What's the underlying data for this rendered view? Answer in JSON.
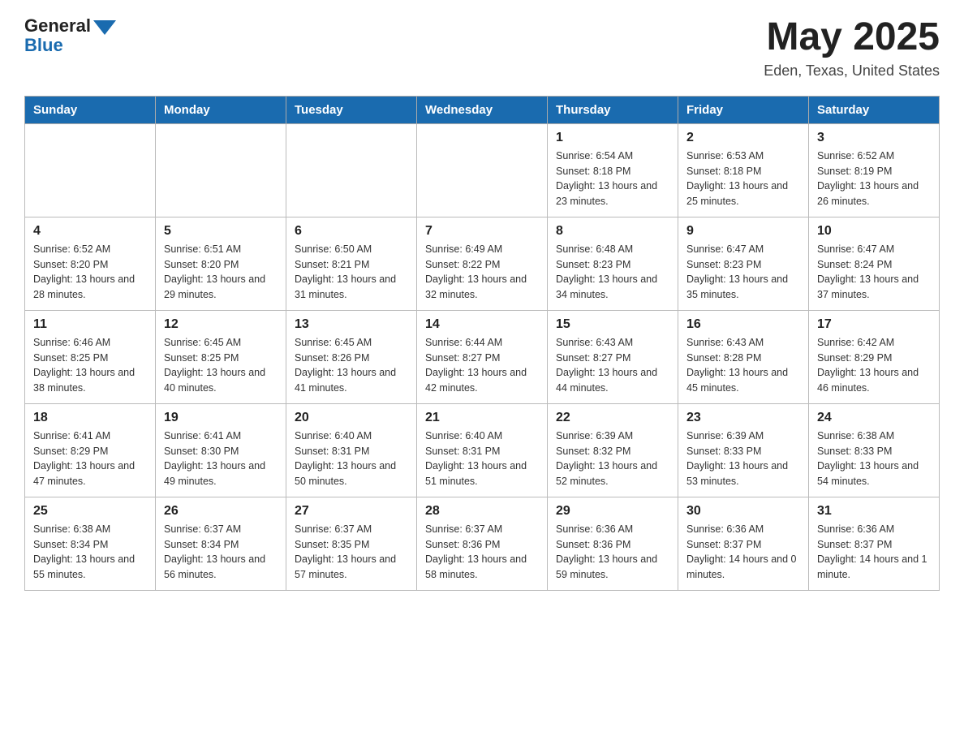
{
  "header": {
    "logo_text_general": "General",
    "logo_text_blue": "Blue",
    "calendar_title": "May 2025",
    "calendar_subtitle": "Eden, Texas, United States"
  },
  "days_of_week": [
    "Sunday",
    "Monday",
    "Tuesday",
    "Wednesday",
    "Thursday",
    "Friday",
    "Saturday"
  ],
  "weeks": [
    [
      {
        "day": "",
        "info": ""
      },
      {
        "day": "",
        "info": ""
      },
      {
        "day": "",
        "info": ""
      },
      {
        "day": "",
        "info": ""
      },
      {
        "day": "1",
        "info": "Sunrise: 6:54 AM\nSunset: 8:18 PM\nDaylight: 13 hours and 23 minutes."
      },
      {
        "day": "2",
        "info": "Sunrise: 6:53 AM\nSunset: 8:18 PM\nDaylight: 13 hours and 25 minutes."
      },
      {
        "day": "3",
        "info": "Sunrise: 6:52 AM\nSunset: 8:19 PM\nDaylight: 13 hours and 26 minutes."
      }
    ],
    [
      {
        "day": "4",
        "info": "Sunrise: 6:52 AM\nSunset: 8:20 PM\nDaylight: 13 hours and 28 minutes."
      },
      {
        "day": "5",
        "info": "Sunrise: 6:51 AM\nSunset: 8:20 PM\nDaylight: 13 hours and 29 minutes."
      },
      {
        "day": "6",
        "info": "Sunrise: 6:50 AM\nSunset: 8:21 PM\nDaylight: 13 hours and 31 minutes."
      },
      {
        "day": "7",
        "info": "Sunrise: 6:49 AM\nSunset: 8:22 PM\nDaylight: 13 hours and 32 minutes."
      },
      {
        "day": "8",
        "info": "Sunrise: 6:48 AM\nSunset: 8:23 PM\nDaylight: 13 hours and 34 minutes."
      },
      {
        "day": "9",
        "info": "Sunrise: 6:47 AM\nSunset: 8:23 PM\nDaylight: 13 hours and 35 minutes."
      },
      {
        "day": "10",
        "info": "Sunrise: 6:47 AM\nSunset: 8:24 PM\nDaylight: 13 hours and 37 minutes."
      }
    ],
    [
      {
        "day": "11",
        "info": "Sunrise: 6:46 AM\nSunset: 8:25 PM\nDaylight: 13 hours and 38 minutes."
      },
      {
        "day": "12",
        "info": "Sunrise: 6:45 AM\nSunset: 8:25 PM\nDaylight: 13 hours and 40 minutes."
      },
      {
        "day": "13",
        "info": "Sunrise: 6:45 AM\nSunset: 8:26 PM\nDaylight: 13 hours and 41 minutes."
      },
      {
        "day": "14",
        "info": "Sunrise: 6:44 AM\nSunset: 8:27 PM\nDaylight: 13 hours and 42 minutes."
      },
      {
        "day": "15",
        "info": "Sunrise: 6:43 AM\nSunset: 8:27 PM\nDaylight: 13 hours and 44 minutes."
      },
      {
        "day": "16",
        "info": "Sunrise: 6:43 AM\nSunset: 8:28 PM\nDaylight: 13 hours and 45 minutes."
      },
      {
        "day": "17",
        "info": "Sunrise: 6:42 AM\nSunset: 8:29 PM\nDaylight: 13 hours and 46 minutes."
      }
    ],
    [
      {
        "day": "18",
        "info": "Sunrise: 6:41 AM\nSunset: 8:29 PM\nDaylight: 13 hours and 47 minutes."
      },
      {
        "day": "19",
        "info": "Sunrise: 6:41 AM\nSunset: 8:30 PM\nDaylight: 13 hours and 49 minutes."
      },
      {
        "day": "20",
        "info": "Sunrise: 6:40 AM\nSunset: 8:31 PM\nDaylight: 13 hours and 50 minutes."
      },
      {
        "day": "21",
        "info": "Sunrise: 6:40 AM\nSunset: 8:31 PM\nDaylight: 13 hours and 51 minutes."
      },
      {
        "day": "22",
        "info": "Sunrise: 6:39 AM\nSunset: 8:32 PM\nDaylight: 13 hours and 52 minutes."
      },
      {
        "day": "23",
        "info": "Sunrise: 6:39 AM\nSunset: 8:33 PM\nDaylight: 13 hours and 53 minutes."
      },
      {
        "day": "24",
        "info": "Sunrise: 6:38 AM\nSunset: 8:33 PM\nDaylight: 13 hours and 54 minutes."
      }
    ],
    [
      {
        "day": "25",
        "info": "Sunrise: 6:38 AM\nSunset: 8:34 PM\nDaylight: 13 hours and 55 minutes."
      },
      {
        "day": "26",
        "info": "Sunrise: 6:37 AM\nSunset: 8:34 PM\nDaylight: 13 hours and 56 minutes."
      },
      {
        "day": "27",
        "info": "Sunrise: 6:37 AM\nSunset: 8:35 PM\nDaylight: 13 hours and 57 minutes."
      },
      {
        "day": "28",
        "info": "Sunrise: 6:37 AM\nSunset: 8:36 PM\nDaylight: 13 hours and 58 minutes."
      },
      {
        "day": "29",
        "info": "Sunrise: 6:36 AM\nSunset: 8:36 PM\nDaylight: 13 hours and 59 minutes."
      },
      {
        "day": "30",
        "info": "Sunrise: 6:36 AM\nSunset: 8:37 PM\nDaylight: 14 hours and 0 minutes."
      },
      {
        "day": "31",
        "info": "Sunrise: 6:36 AM\nSunset: 8:37 PM\nDaylight: 14 hours and 1 minute."
      }
    ]
  ]
}
